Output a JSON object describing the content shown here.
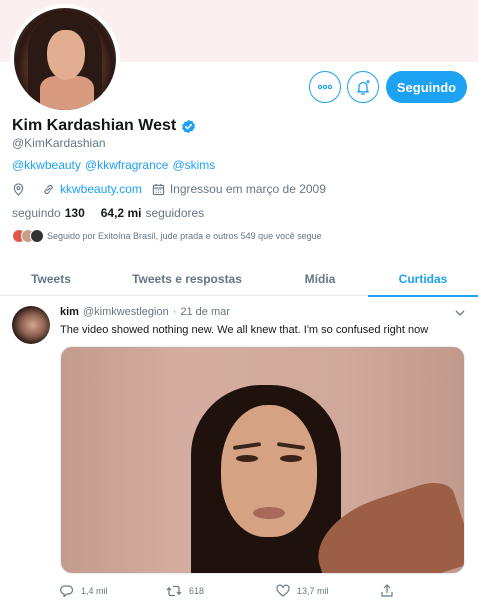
{
  "profile": {
    "name": "Kim Kardashian West",
    "handle": "@KimKardashian",
    "bio_links": [
      "@kkwbeauty",
      "@kkwfragrance",
      "@skims"
    ],
    "website": "kkwbeauty.com",
    "joined": "Ingressou em março de 2009",
    "following_label": "seguindo",
    "following_count": "130",
    "followers_count": "64,2 mi",
    "followers_label": "seguidores",
    "followed_by": "Seguido por Exitoína Brasil, jude prada e outros 549 que você segue"
  },
  "buttons": {
    "follow_label": "Seguindo"
  },
  "tabs": [
    {
      "label": "Tweets",
      "active": false
    },
    {
      "label": "Tweets e respostas",
      "active": false
    },
    {
      "label": "Mídia",
      "active": false
    },
    {
      "label": "Curtidas",
      "active": true
    }
  ],
  "tweet": {
    "author_name": "kim",
    "author_handle": "@kimkwestlegion",
    "separator": "·",
    "date": "21 de mar",
    "text": "The video showed nothing new. We all knew that. I'm so confused right now",
    "replies": "1,4 mil",
    "retweets": "618",
    "likes": "13,7 mil"
  },
  "colors": {
    "accent": "#1da1f2",
    "text": "#14171a",
    "muted": "#657786",
    "banner": "#fbf0ef"
  },
  "icons": [
    "more-icon",
    "notification-bell-icon",
    "verified-badge-icon",
    "location-icon",
    "link-icon",
    "calendar-icon",
    "chevron-down-icon",
    "reply-icon",
    "retweet-icon",
    "like-icon",
    "share-icon"
  ]
}
